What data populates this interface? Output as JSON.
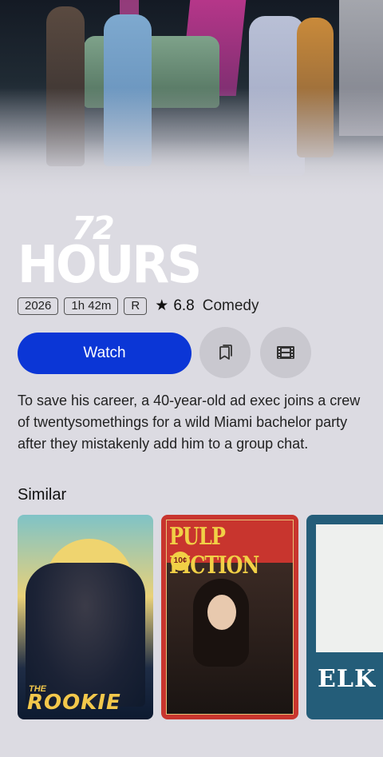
{
  "movie": {
    "title_number": "72",
    "title_word": "HOURS",
    "year": "2026",
    "duration": "1h 42m",
    "rating_badge": "R",
    "score": "6.8",
    "genre": "Comedy",
    "description": "To save his career, a 40-year-old ad exec joins a crew of twentysomethings for a wild Miami bachelor party after they mistakenly add him to a group chat."
  },
  "actions": {
    "watch_label": "Watch",
    "bookmark_icon": "bookmark-icon",
    "trailer_icon": "film-icon"
  },
  "similar": {
    "heading": "Similar",
    "items": [
      {
        "the": "THE",
        "title": "ROOKIE"
      },
      {
        "title": "PULP FICTION",
        "badge": "10¢"
      },
      {
        "title": "ELK"
      }
    ]
  },
  "colors": {
    "background": "#dcdbe2",
    "accent": "#0b36d6",
    "circle_button": "#c9c8cf"
  }
}
